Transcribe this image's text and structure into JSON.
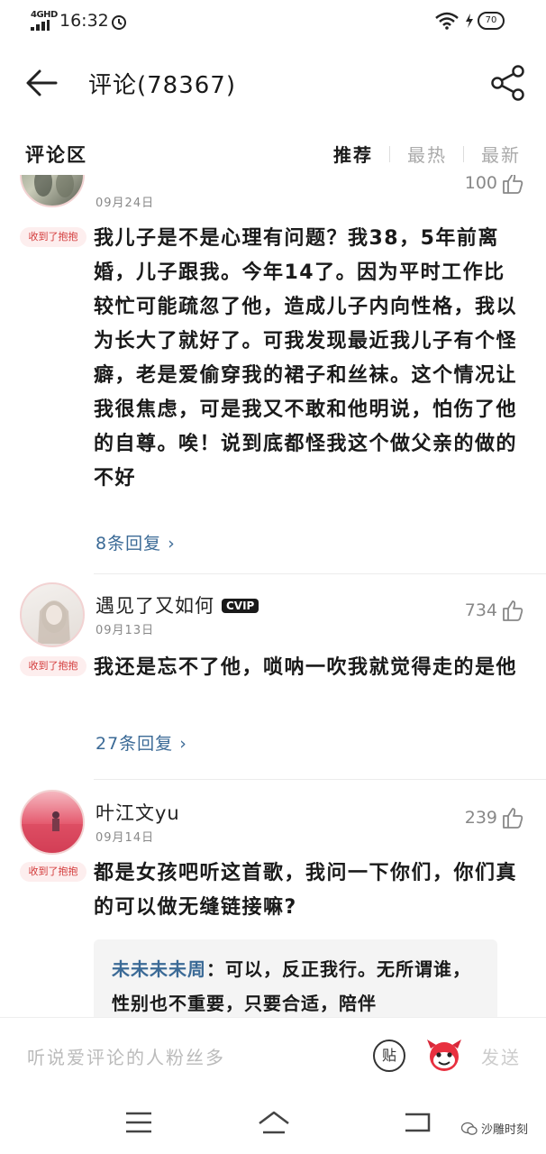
{
  "status_bar": {
    "network": "4GHD",
    "time": "16:32",
    "battery": "70"
  },
  "header": {
    "title": "评论(78367)"
  },
  "section": {
    "title": "评论区",
    "tabs": [
      "推荐",
      "最热",
      "最新"
    ]
  },
  "comments": [
    {
      "date": "09月24日",
      "likes": "100",
      "badge": "收到了抱抱",
      "text": "我儿子是不是心理有问题？我38，5年前离婚，儿子跟我。今年14了。因为平时工作比较忙可能疏忽了他，造成儿子内向性格，我以为长大了就好了。可我发现最近我儿子有个怪癖，老是爱偷穿我的裙子和丝袜。这个情况让我很焦虑，可是我又不敢和他明说，怕伤了他的自尊。唉！说到底都怪我这个做父亲的做的不好",
      "replies": "8条回复 ›"
    },
    {
      "username": "遇见了又如何",
      "vip": "CVIP",
      "date": "09月13日",
      "likes": "734",
      "badge": "收到了抱抱",
      "text": "我还是忘不了他，唢呐一吹我就觉得走的是他",
      "replies": "27条回复 ›"
    },
    {
      "username": "叶江文yu",
      "date": "09月14日",
      "likes": "239",
      "badge": "收到了抱抱",
      "text": "都是女孩吧听这首歌，我问一下你们，你们真的可以做无缝链接嘛?",
      "reply_author": "未未未未周",
      "reply_text": "：可以，反正我行。无所谓谁，性别也不重要，只要合适，陪伴"
    }
  ],
  "input_bar": {
    "placeholder": "听说爱评论的人粉丝多",
    "sticker": "贴",
    "send": "发送"
  },
  "watermark": "沙雕时刻"
}
